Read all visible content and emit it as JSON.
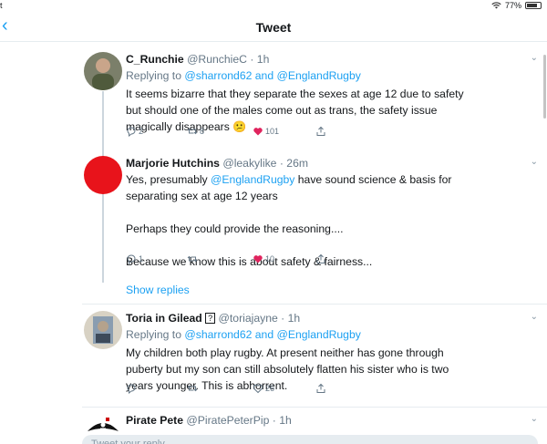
{
  "status_bar": {
    "carrier": "t",
    "battery": "77%"
  },
  "nav": {
    "title": "Tweet"
  },
  "tweets": [
    {
      "name": "C_Runchie",
      "handle": "@RunchieC",
      "time": "· 1h",
      "replying_prefix": "Replying to ",
      "replying_a": "@sharrond62",
      "replying_and": " and ",
      "replying_b": "@EnglandRugby",
      "lines": [
        "It seems bizarre that they separate the sexes at age 12 due to safety",
        "but should one of the males come out as trans, the safety issue",
        "magically disappears 😕"
      ],
      "replies": "2",
      "retweets": "8",
      "likes": "101"
    },
    {
      "name": "Marjorie Hutchins",
      "handle": "@leakylike",
      "time": "· 26m",
      "line1_prefix": "Yes, presumably ",
      "line1_link": "@EnglandRugby",
      "line1_suffix": " have sound science & basis for",
      "line2": "separating sex at age 12 years",
      "para2": "Perhaps they could provide the reasoning....",
      "para3": "Because we know this is about safety & fairness...",
      "replies": "1",
      "retweets": "",
      "likes": "10"
    },
    {
      "name": "Toria in Gilead",
      "badge": "?",
      "handle": "@toriajayne",
      "time": "· 1h",
      "replying_prefix": "Replying to ",
      "replying_a": "@sharrond62",
      "replying_and": " and ",
      "replying_b": "@EnglandRugby",
      "lines": [
        "My children both play rugby. At present neither has gone through",
        "puberty but my son can still absolutely flatten his sister who is two",
        "years younger. This is abhorrent."
      ],
      "replies": "",
      "retweets": "",
      "likes": "26"
    },
    {
      "name": "Pirate Pete",
      "handle": "@PiratePeterPip",
      "time": "· 1h"
    }
  ],
  "show_replies": "Show replies",
  "compose": {
    "placeholder": "Tweet your reply"
  },
  "colors": {
    "accent": "#1da1f2",
    "like": "#e0245e",
    "avatar_red": "#e8131b"
  }
}
